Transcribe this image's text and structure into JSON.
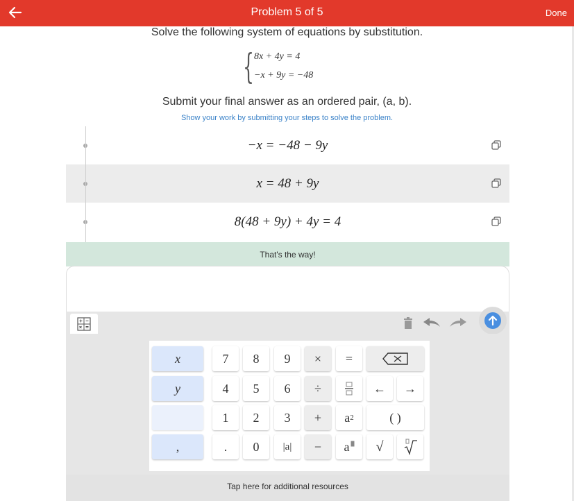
{
  "header": {
    "title": "Problem 5 of 5",
    "done_label": "Done"
  },
  "problem": {
    "instruction": "Solve the following system of equations by substitution.",
    "equations": [
      "8x + 4y = 4",
      "−x + 9y = −48"
    ],
    "submit_text": "Submit your final answer as an ordered pair, (a, b).",
    "show_work_link": "Show your work by submitting your steps to solve the problem."
  },
  "steps": [
    {
      "expr": "−x = −48 − 9y"
    },
    {
      "expr": "x = 48 + 9y"
    },
    {
      "expr": "8(48 + 9y) + 4y = 4"
    }
  ],
  "feedback": "That's the way!",
  "keypad": {
    "variables": [
      "x",
      "y",
      "",
      ","
    ],
    "row1": [
      "7",
      "8",
      "9",
      "×",
      "="
    ],
    "row2": [
      "4",
      "5",
      "6",
      "÷",
      "←",
      "→"
    ],
    "row3": [
      "1",
      "2",
      "3",
      "+",
      "( )"
    ],
    "row4": [
      ".",
      "0",
      "|a|",
      "−",
      "√"
    ],
    "square_base": "a",
    "square_exp": "2",
    "power_base": "a"
  },
  "resources_label": "Tap here for additional resources",
  "colors": {
    "header": "#e2392b",
    "link": "#3a82c8",
    "feedback_bg": "#d3e7dc",
    "variable_key": "#dbe7fb",
    "up_button": "#4a8fe0"
  }
}
